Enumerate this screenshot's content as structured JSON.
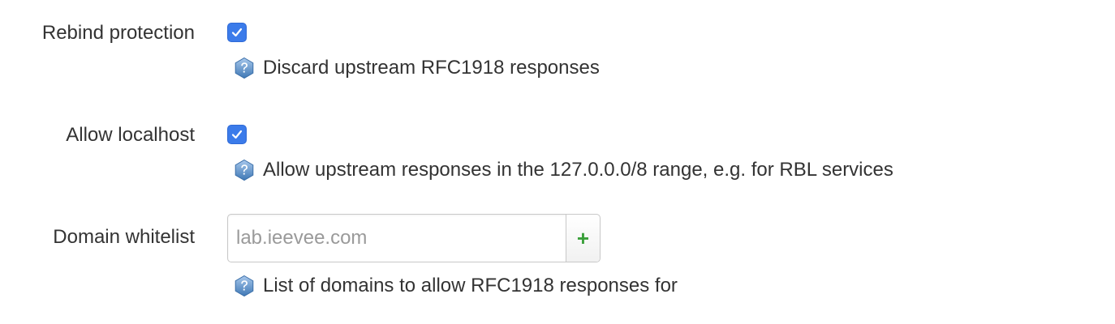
{
  "rebind_protection": {
    "label": "Rebind protection",
    "checked": true,
    "description": "Discard upstream RFC1918 responses"
  },
  "allow_localhost": {
    "label": "Allow localhost",
    "checked": true,
    "description": "Allow upstream responses in the 127.0.0.0/8 range, e.g. for RBL services"
  },
  "domain_whitelist": {
    "label": "Domain whitelist",
    "value": "",
    "placeholder": "lab.ieevee.com",
    "add_button_label": "+",
    "description": "List of domains to allow RFC1918 responses for"
  },
  "colors": {
    "checkbox_accent": "#3b7bea",
    "add_button_text": "#3aa03a",
    "help_icon": "#5b8fc7"
  },
  "icons": {
    "checkbox": "checkmark-icon",
    "help": "help-icon"
  }
}
